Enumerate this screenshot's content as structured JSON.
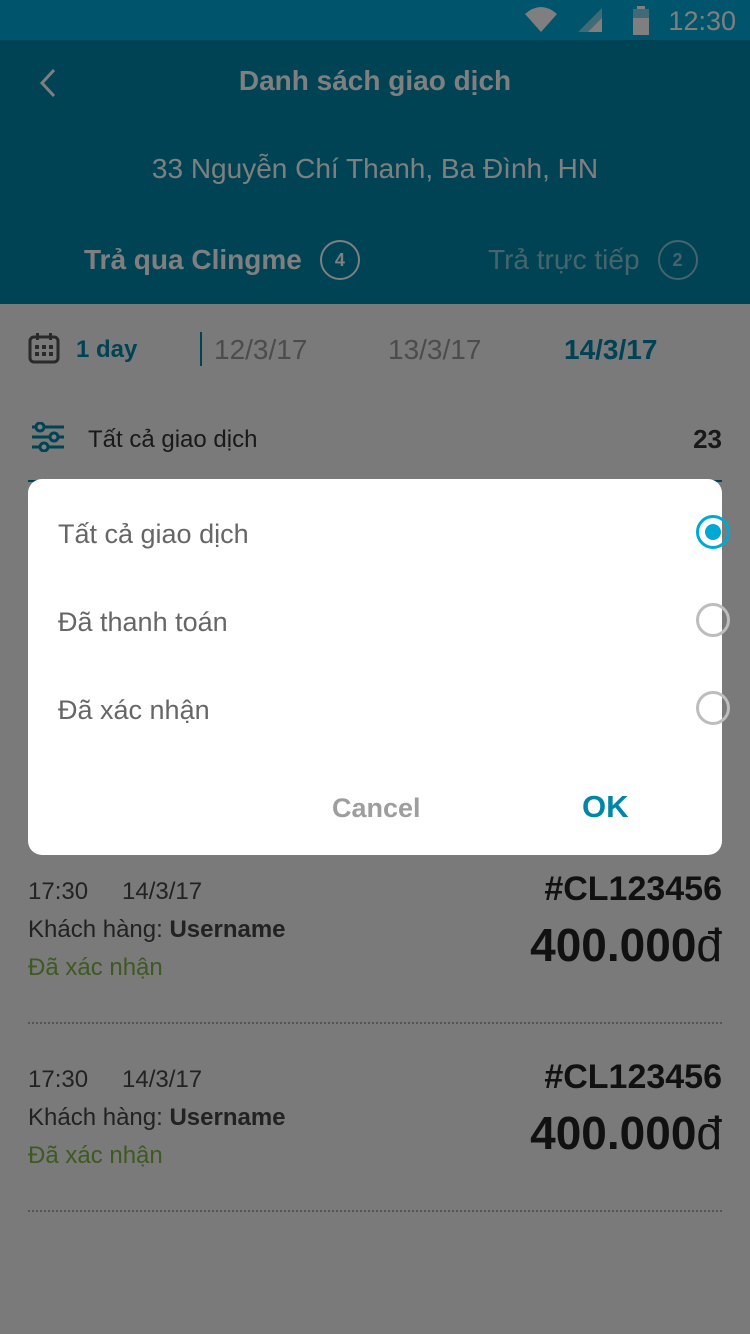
{
  "status_bar": {
    "time": "12:30",
    "wifi_icon": "wifi-icon",
    "signal_icon": "signal-icon",
    "battery_icon": "battery-icon"
  },
  "header": {
    "title": "Danh sách giao dịch",
    "address": "33 Nguyễn Chí Thanh, Ba Đình, HN",
    "tabs": [
      {
        "label": "Trả qua Clingme",
        "count": "4",
        "active": true
      },
      {
        "label": "Trả trực tiếp",
        "count": "2",
        "active": false
      }
    ]
  },
  "date_bar": {
    "range_label": "1 day",
    "dates": [
      "12/3/17",
      "13/3/17",
      "14/3/17"
    ],
    "active_date": "14/3/17"
  },
  "filter": {
    "label": "Tất cả giao dịch",
    "count": "23"
  },
  "transactions": [
    {
      "time": "17:30",
      "date": "14/3/17",
      "customer_prefix": "Khách hàng:",
      "customer": "Username",
      "status": "Đã xác nhận",
      "code": "#CL123456",
      "amount": "400.000",
      "currency": "đ"
    },
    {
      "time": "17:30",
      "date": "14/3/17",
      "customer_prefix": "Khách hàng:",
      "customer": "Username",
      "status": "Đã xác nhận",
      "code": "#CL123456",
      "amount": "400.000",
      "currency": "đ"
    }
  ],
  "dialog": {
    "options": [
      {
        "label": "Tất cả giao dịch",
        "selected": true
      },
      {
        "label": "Đã thanh toán",
        "selected": false
      },
      {
        "label": "Đã xác nhận",
        "selected": false
      }
    ],
    "cancel_label": "Cancel",
    "ok_label": "OK"
  },
  "colors": {
    "primary": "#0086a8",
    "status_bar": "#00a8d6",
    "confirmed": "#7cb342"
  }
}
